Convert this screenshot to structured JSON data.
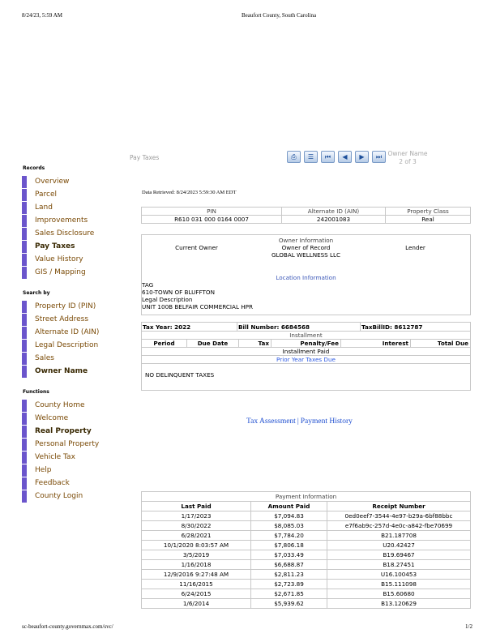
{
  "print_header": {
    "datetime": "8/24/23, 5:59 AM",
    "site_title": "Beaufort County, South Carolina"
  },
  "print_footer": {
    "url": "sc-beaufort-county.governmax.com/svc/",
    "page": "1/2"
  },
  "sidebar": {
    "records": {
      "heading": "Records",
      "items": [
        "Overview",
        "Parcel",
        "Land",
        "Improvements",
        "Sales Disclosure",
        "Pay Taxes",
        "Value History",
        "GIS / Mapping"
      ]
    },
    "search": {
      "heading": "Search by",
      "items": [
        "Property ID (PIN)",
        "Street Address",
        "Alternate ID (AIN)",
        "Legal Description",
        "Sales",
        "Owner Name"
      ]
    },
    "functions": {
      "heading": "Functions",
      "items": [
        "County Home",
        "Welcome",
        "Real Property",
        "Personal Property",
        "Vehicle Tax",
        "Help",
        "Feedback",
        "County Login"
      ]
    }
  },
  "toolbar": {
    "page_title": "Pay Taxes",
    "owner_name_label": "Owner Name",
    "owner_name_pos": "2 of 3",
    "icons": [
      "print-icon",
      "list-icon",
      "first-record-icon",
      "previous-record-icon",
      "next-record-icon",
      "last-record-icon"
    ]
  },
  "data_retrieved": "Data Retrieved: 8/24/2023 5:59:30 AM EDT",
  "parcel_ids": {
    "headers": [
      "PIN",
      "Alternate ID (AIN)",
      "Property Class"
    ],
    "values": [
      "R610 031 000 0164 0007",
      "242001083",
      "Real"
    ]
  },
  "owner_info": {
    "title": "Owner Information",
    "current_owner_label": "Current Owner",
    "owner_of_record_label": "Owner of Record",
    "lender_label": "Lender",
    "owner_name": "GLOBAL WELLNESS LLC",
    "location_title": "Location Information",
    "location_lines": [
      "TAG",
      "610-TOWN OF BLUFFTON",
      "Legal Description",
      "UNIT 100B BELFAIR COMMERCIAL HPR"
    ]
  },
  "tax_info": {
    "tax_year": "Tax Year: 2022",
    "bill_number": "Bill Number: 6684568",
    "tax_bill_id": "TaxBillID: 8612787",
    "installment_title": "Installment",
    "columns": [
      "Period",
      "Due Date",
      "Tax",
      "Penalty/Fee",
      "Interest",
      "Total Due"
    ],
    "installment_status": "Installment Paid",
    "prior_year_link": "Prior Year Taxes Due",
    "delinquent_status": "NO DELINQUENT TAXES"
  },
  "links": {
    "tax_assessment": "Tax Assessment",
    "separator": "|",
    "payment_history": "Payment History"
  },
  "payment_info": {
    "title": "Payment Information",
    "headers": [
      "Last Paid",
      "Amount Paid",
      "Receipt Number"
    ],
    "rows": [
      [
        "1/17/2023",
        "$7,094.83",
        "0ed0eef7-3544-4e97-b29a-6bf88bbc"
      ],
      [
        "8/30/2022",
        "$8,085.03",
        "e7f6ab9c-257d-4e0c-a842-fbe70699"
      ],
      [
        "6/28/2021",
        "$7,784.20",
        "B21.187708"
      ],
      [
        "10/1/2020 8:03:57 AM",
        "$7,806.18",
        "U20.42427"
      ],
      [
        "3/5/2019",
        "$7,033.49",
        "B19.69467"
      ],
      [
        "1/16/2018",
        "$6,688.87",
        "B18.27451"
      ],
      [
        "12/9/2016 9:27:48 AM",
        "$2,811.23",
        "U16.100453"
      ],
      [
        "11/16/2015",
        "$2,723.89",
        "B15.111098"
      ],
      [
        "6/24/2015",
        "$2,671.85",
        "B15.60680"
      ],
      [
        "1/6/2014",
        "$5,939.62",
        "B13.120629"
      ]
    ]
  }
}
